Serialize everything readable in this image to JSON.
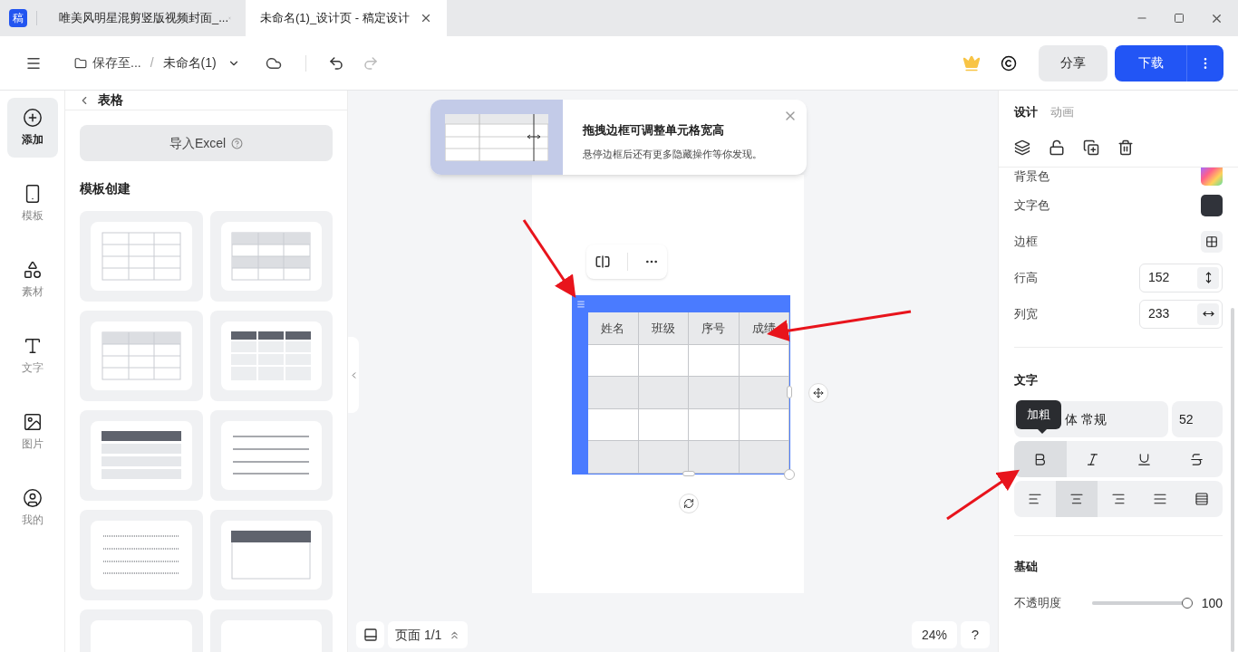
{
  "browser_tabs": [
    {
      "title": "唯美风明星混剪竖版视频封面_...",
      "selected": false
    },
    {
      "title": "未命名(1)_设计页 - 稿定设计",
      "selected": true
    }
  ],
  "app_icon": "稿",
  "toolbar": {
    "save_location": "保存至...",
    "separator": "/",
    "file_name": "未命名(1)",
    "share": "分享",
    "download": "下载"
  },
  "rail": [
    {
      "kind": "add",
      "label": "添加",
      "selected": true
    },
    {
      "kind": "template",
      "label": "模板",
      "selected": false
    },
    {
      "kind": "material",
      "label": "素材",
      "selected": false
    },
    {
      "kind": "text",
      "label": "文字",
      "selected": false
    },
    {
      "kind": "image",
      "label": "图片",
      "selected": false
    },
    {
      "kind": "mine",
      "label": "我的",
      "selected": false
    }
  ],
  "panel": {
    "title": "表格",
    "import": "导入Excel",
    "section": "模板创建",
    "templates": [
      {
        "kind": "grid"
      },
      {
        "kind": "striped"
      },
      {
        "kind": "header-light"
      },
      {
        "kind": "header-dark"
      },
      {
        "kind": "bar-rows"
      },
      {
        "kind": "lines"
      },
      {
        "kind": "dotted"
      },
      {
        "kind": "header-box"
      },
      {
        "kind": "blank"
      },
      {
        "kind": "blank"
      }
    ]
  },
  "tip": {
    "title": "拖拽边框可调整单元格宽高",
    "text": "悬停边框后还有更多隐藏操作等你发现。"
  },
  "table": {
    "headers": [
      "姓名",
      "班级",
      "序号",
      "成绩"
    ],
    "rows": [
      {
        "shaded": false
      },
      {
        "shaded": true
      },
      {
        "shaded": false
      },
      {
        "shaded": true
      }
    ]
  },
  "page_nav": {
    "label": "页面 1/1"
  },
  "zoom": "24%",
  "help": "?",
  "inspector": {
    "tabs": [
      {
        "label": "设计",
        "selected": true
      },
      {
        "label": "动画",
        "selected": false
      }
    ],
    "properties": [
      {
        "kind": "gradient",
        "label": "背景色"
      },
      {
        "kind": "swatch",
        "label": "文字色",
        "color": "#30333a"
      },
      {
        "kind": "border",
        "label": "边框"
      },
      {
        "kind": "height",
        "label": "行高",
        "value": "152"
      },
      {
        "kind": "width",
        "label": "列宽",
        "value": "233"
      }
    ],
    "text_title": "文字",
    "font": "体 常规",
    "font_size": "52",
    "tooltip": "加粗",
    "styles": [
      {
        "kind": "bold",
        "selected": true
      },
      {
        "kind": "italic",
        "selected": false
      },
      {
        "kind": "underline",
        "selected": false
      },
      {
        "kind": "strike",
        "selected": false
      }
    ],
    "aligns": [
      {
        "kind": "left",
        "selected": false
      },
      {
        "kind": "center",
        "selected": true
      },
      {
        "kind": "right",
        "selected": false
      },
      {
        "kind": "justify",
        "selected": false
      },
      {
        "kind": "distribute",
        "selected": false
      }
    ],
    "basics_title": "基础",
    "opacity": {
      "label": "不透明度",
      "level": 1,
      "value": "100"
    }
  }
}
